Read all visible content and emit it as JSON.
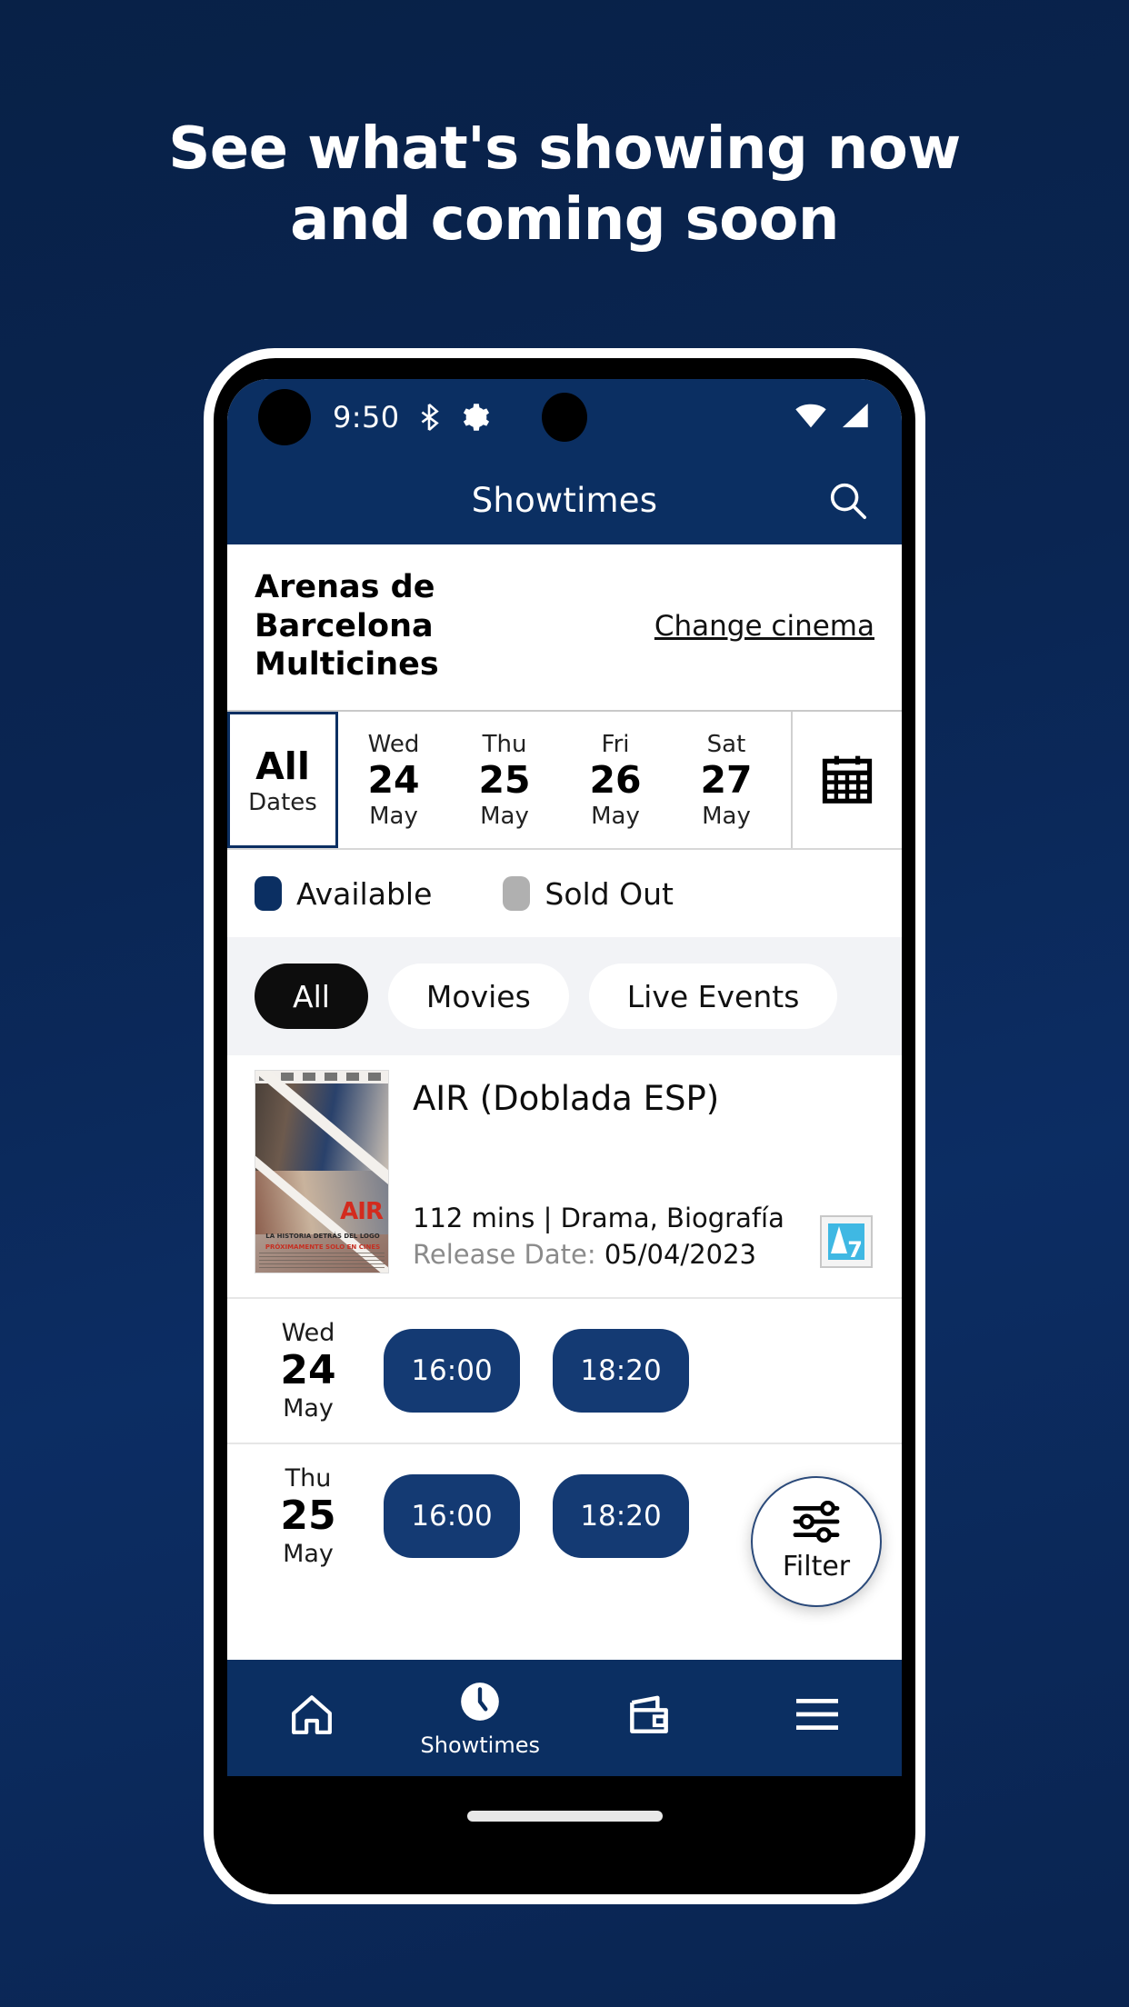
{
  "promo": {
    "headline_line1": "See what's showing now",
    "headline_line2": "and coming soon",
    "background_color": "#0a2450"
  },
  "status_bar": {
    "time": "9:50",
    "icons": [
      "bluetooth-icon",
      "gear-icon",
      "wifi-icon",
      "signal-icon"
    ]
  },
  "app_bar": {
    "title": "Showtimes",
    "search_icon": "search-icon"
  },
  "cinema": {
    "name": "Arenas de Barcelona Multicines",
    "change_label": "Change cinema"
  },
  "date_strip": {
    "calendar_icon": "calendar-icon",
    "items": [
      {
        "dow": "",
        "num": "All",
        "mon": "Dates",
        "selected": true
      },
      {
        "dow": "Wed",
        "num": "24",
        "mon": "May",
        "selected": false
      },
      {
        "dow": "Thu",
        "num": "25",
        "mon": "May",
        "selected": false
      },
      {
        "dow": "Fri",
        "num": "26",
        "mon": "May",
        "selected": false
      },
      {
        "dow": "Sat",
        "num": "27",
        "mon": "May",
        "selected": false
      }
    ]
  },
  "legend": {
    "available_label": "Available",
    "available_color": "#0b2f62",
    "soldout_label": "Sold Out",
    "soldout_color": "#b0b0b0"
  },
  "chips": [
    {
      "label": "All",
      "active": true
    },
    {
      "label": "Movies",
      "active": false
    },
    {
      "label": "Live Events",
      "active": false
    }
  ],
  "movie": {
    "title": "AIR (Doblada ESP)",
    "meta": "112 mins | Drama, Biografía",
    "release_label": "Release Date:",
    "release_date": "05/04/2023",
    "rating_badge": "7",
    "rating_badge_color": "#3fb8e3",
    "poster": {
      "title_text": "AIR",
      "tagline": "LA HISTORIA DETRÁS DEL LOGO",
      "subline": "PRÓXIMAMENTE SOLO EN CINES"
    }
  },
  "showtimes": [
    {
      "dow": "Wed",
      "num": "24",
      "mon": "May",
      "times": [
        "16:00",
        "18:20"
      ]
    },
    {
      "dow": "Thu",
      "num": "25",
      "mon": "May",
      "times": [
        "16:00",
        "18:20"
      ]
    }
  ],
  "fab": {
    "label": "Filter",
    "icon": "sliders-icon"
  },
  "bottom_nav": [
    {
      "icon": "home-icon",
      "label": ""
    },
    {
      "icon": "clock-icon",
      "label": "Showtimes"
    },
    {
      "icon": "wallet-icon",
      "label": ""
    },
    {
      "icon": "hamburger-menu-icon",
      "label": ""
    }
  ]
}
